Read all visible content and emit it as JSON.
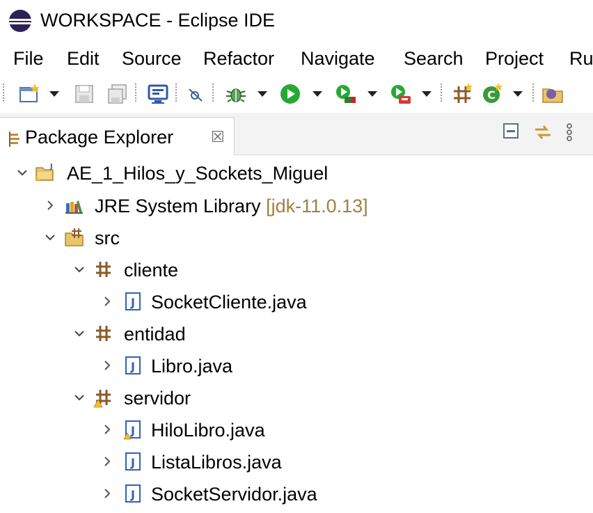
{
  "window": {
    "title": "WORKSPACE - Eclipse IDE"
  },
  "menu": [
    "File",
    "Edit",
    "Source",
    "Refactor",
    "Navigate",
    "Search",
    "Project",
    "Ru"
  ],
  "view": {
    "tab_label": "Package Explorer",
    "close_glyph": "☒"
  },
  "tree": {
    "project": "AE_1_Hilos_y_Sockets_Miguel",
    "jre_label": "JRE System Library",
    "jre_version": "[jdk-11.0.13]",
    "src": "src",
    "pkg_cliente": "cliente",
    "file_socketcliente": "SocketCliente.java",
    "pkg_entidad": "entidad",
    "file_libro": "Libro.java",
    "pkg_servidor": "servidor",
    "file_hilolibro": "HiloLibro.java",
    "file_listalibros": "ListaLibros.java",
    "file_socketservidor": "SocketServidor.java"
  },
  "icons": {
    "expanded": "chevron-down-icon",
    "collapsed": "chevron-right-icon",
    "project": "java-project-icon",
    "library": "library-icon",
    "source_folder": "source-folder-icon",
    "package": "package-icon",
    "java_file": "java-file-icon"
  },
  "colors": {
    "package_brown": "#8a5a2b",
    "java_blue": "#2f63b3",
    "decoration": "#a08040"
  }
}
